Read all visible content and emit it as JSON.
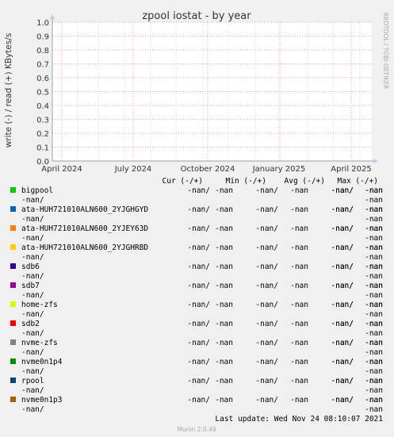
{
  "chart_data": {
    "type": "line",
    "title": "zpool iostat - by year",
    "ylabel": "write (-) / read (+) KBytes/s",
    "ylim": [
      0,
      1.0
    ],
    "y_ticks": [
      "0.0",
      "0.1",
      "0.2",
      "0.3",
      "0.4",
      "0.5",
      "0.6",
      "0.7",
      "0.8",
      "0.9",
      "1.0"
    ],
    "x_ticks": [
      "April 2024",
      "July 2024",
      "October 2024",
      "January 2025",
      "April 2025"
    ],
    "grid": true,
    "series": []
  },
  "side_label": "RRDTOOL / TOBI OETIKER",
  "legend": {
    "headers": [
      "Cur (-/+)",
      "Min (-/+)",
      "Avg (-/+)",
      "Max (-/+)"
    ],
    "items": [
      {
        "name": "bigpool",
        "color": "#00cc00",
        "cur": "-nan/",
        "cur2": "-nan",
        "min": "-nan/",
        "min2": "-nan",
        "avg": "-nan/",
        "avg2": "-nan",
        "max": "-nan/",
        "max2": "-nan"
      },
      {
        "name": "ata-HUH721010ALN600_2YJGHGYD",
        "color": "#0066b3",
        "cur": "-nan/",
        "cur2": "-nan",
        "min": "-nan/",
        "min2": "-nan",
        "avg": "-nan/",
        "avg2": "-nan",
        "max": "-nan/",
        "max2": "-nan"
      },
      {
        "name": "ata-HUH721010ALN600_2YJEY63D",
        "color": "#ff8000",
        "cur": "-nan/",
        "cur2": "-nan",
        "min": "-nan/",
        "min2": "-nan",
        "avg": "-nan/",
        "avg2": "-nan",
        "max": "-nan/",
        "max2": "-nan"
      },
      {
        "name": "ata-HUH721010ALN600_2YJGHRBD",
        "color": "#ffcc00",
        "cur": "-nan/",
        "cur2": "-nan",
        "min": "-nan/",
        "min2": "-nan",
        "avg": "-nan/",
        "avg2": "-nan",
        "max": "-nan/",
        "max2": "-nan"
      },
      {
        "name": "sdb6",
        "color": "#330099",
        "cur": "-nan/",
        "cur2": "-nan",
        "min": "-nan/",
        "min2": "-nan",
        "avg": "-nan/",
        "avg2": "-nan",
        "max": "-nan/",
        "max2": "-nan"
      },
      {
        "name": "sdb7",
        "color": "#990099",
        "cur": "-nan/",
        "cur2": "-nan",
        "min": "-nan/",
        "min2": "-nan",
        "avg": "-nan/",
        "avg2": "-nan",
        "max": "-nan/",
        "max2": "-nan"
      },
      {
        "name": "home-zfs",
        "color": "#ccff00",
        "cur": "-nan/",
        "cur2": "-nan",
        "min": "-nan/",
        "min2": "-nan",
        "avg": "-nan/",
        "avg2": "-nan",
        "max": "-nan/",
        "max2": "-nan"
      },
      {
        "name": "sdb2",
        "color": "#ff0000",
        "cur": "-nan/",
        "cur2": "-nan",
        "min": "-nan/",
        "min2": "-nan",
        "avg": "-nan/",
        "avg2": "-nan",
        "max": "-nan/",
        "max2": "-nan"
      },
      {
        "name": "nvme-zfs",
        "color": "#808080",
        "cur": "-nan/",
        "cur2": "-nan",
        "min": "-nan/",
        "min2": "-nan",
        "avg": "-nan/",
        "avg2": "-nan",
        "max": "-nan/",
        "max2": "-nan"
      },
      {
        "name": "nvme0n1p4",
        "color": "#008f00",
        "cur": "-nan/",
        "cur2": "-nan",
        "min": "-nan/",
        "min2": "-nan",
        "avg": "-nan/",
        "avg2": "-nan",
        "max": "-nan/",
        "max2": "-nan"
      },
      {
        "name": "rpool",
        "color": "#00487d",
        "cur": "-nan/",
        "cur2": "-nan",
        "min": "-nan/",
        "min2": "-nan",
        "avg": "-nan/",
        "avg2": "-nan",
        "max": "-nan/",
        "max2": "-nan"
      },
      {
        "name": "nvme0n1p3",
        "color": "#b35a00",
        "cur": "-nan/",
        "cur2": "-nan",
        "min": "-nan/",
        "min2": "-nan",
        "avg": "-nan/",
        "avg2": "-nan",
        "max": "-nan/",
        "max2": "-nan"
      }
    ]
  },
  "last_update": "Last update: Wed Nov 24 08:10:07 2021",
  "footer": "Munin 2.0.49",
  "colors": {
    "background": "#f0f0f0",
    "plot_bg": "#ffffff",
    "major_grid": "#e8a0a0",
    "minor_grid": "#f0c8c8",
    "axis": "#a0a0a0",
    "arrow": "#c8c8f0"
  }
}
